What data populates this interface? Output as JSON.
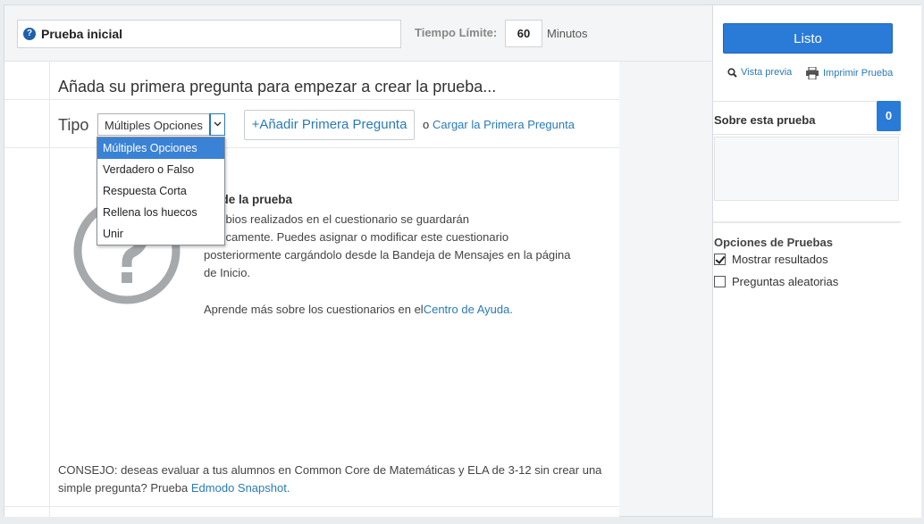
{
  "header": {
    "quiz_title": "Prueba inicial",
    "time_label": "Tiempo Límite:",
    "time_value": "60",
    "time_unit": "Minutos"
  },
  "main": {
    "headline": "Añada su primera pregunta para empezar a crear la prueba...",
    "type_label": "Tipo",
    "type_selected": "Múltiples Opciones",
    "type_options": [
      "Múltiples Opciones",
      "Verdadero o Falso",
      "Respuesta Corta",
      "Rellena los huecos",
      "Unir"
    ],
    "add_button": "+Añadir Primera Pregunta",
    "or_text": "o",
    "load_link": "Cargar la Primera Pregunta",
    "help_title": "da de la prueba",
    "help_lines": [
      "cambios realizados en el cuestionario se guardarán",
      "máticamente. Puedes asignar o modificar este cuestionario",
      "posteriormente cargándolo desde la Bandeja de Mensajes en la página",
      "de Inicio."
    ],
    "help_more_prefix": "Aprende más sobre los cuestionarios en el",
    "help_more_link": "Centro de Ayuda",
    "help_more_suffix": ".",
    "tip_prefix": "CONSEJO: deseas evaluar a tus alumnos en Common Core de Matemáticas y ELA de 3-12 sin crear una simple pregunta? Prueba ",
    "tip_link": "Edmodo Snapshot",
    "tip_suffix": "."
  },
  "sidebar": {
    "done_button": "Listo",
    "preview_link": "Vista previa",
    "print_link": "Imprimir Prueba",
    "about_title": "Sobre esta prueba",
    "about_count": "0",
    "options_title": "Opciones de Pruebas",
    "options": [
      {
        "label": "Mostrar resultados",
        "checked": true
      },
      {
        "label": "Preguntas aleatorias",
        "checked": false
      }
    ]
  },
  "colors": {
    "accent": "#2a7ad8",
    "link": "#2a7ab8",
    "dropdown_highlight": "#3a82d6"
  }
}
